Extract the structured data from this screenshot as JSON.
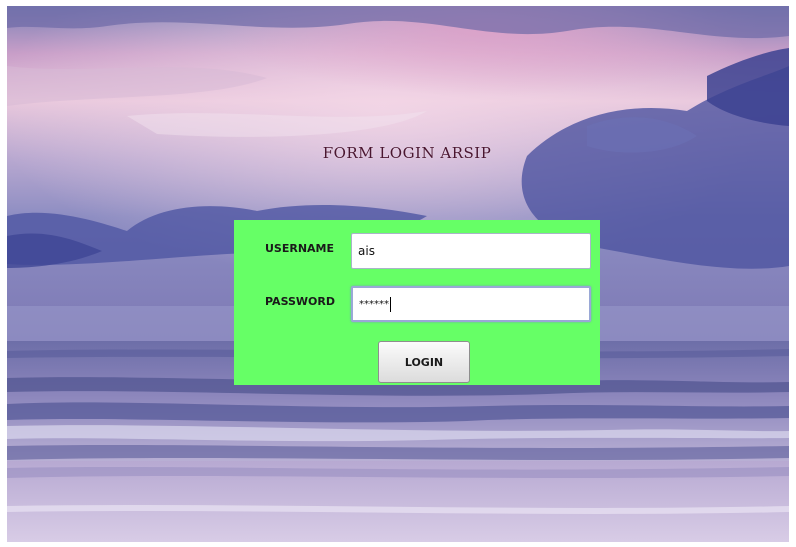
{
  "form": {
    "title": "FORM LOGIN ARSIP",
    "username_label": "USERNAME",
    "username_value": "ais",
    "password_label": "PASSWORD",
    "password_value": "******",
    "login_label": "LOGIN"
  },
  "colors": {
    "panel": "#66ff66",
    "title": "#4a1630"
  }
}
